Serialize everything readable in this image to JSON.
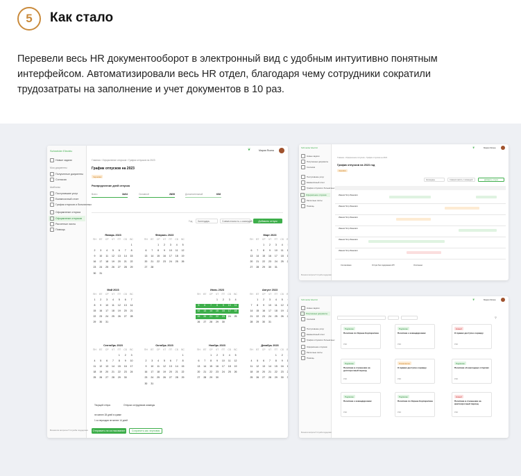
{
  "step_number": "5",
  "section_title": "Как стало",
  "description": "Перевели весь HR документооборот в электронный вид с удобным интуитивно понятным интерфейсом. Автоматизировали весь HR отдел, благодаря чему сотрудники сократили трудозатраты на заполнение и учет документов в 10 раз.",
  "colors": {
    "accent": "#c98a3b",
    "brand_green": "#3dae4a",
    "band_bg": "#eef0f4"
  },
  "app": {
    "brand": "Schneider Electric",
    "user_name": "Мария Ясина",
    "sidebar": [
      "Новые задачи",
      "Мои документы",
      "Полученные документы",
      "Согласия",
      "Шаблоны",
      "Поступившие услуг",
      "Ежемесячный отчет",
      "График отпусков и больничных",
      "Оформление отпуска",
      "Оформление отпусков",
      "Расчетные листы",
      "Помощь"
    ],
    "sidebar_footer": "Возникли вопросы? Служба поддержки",
    "breadcrumb": "Главная › Оформление отпусков › График отпусков на 2023",
    "title": "График отпусков на 2023",
    "status_badge": "Черновик",
    "distribution_title": "Распределение дней отпуска",
    "stats": [
      {
        "label": "Всего",
        "value": "34/44"
      },
      {
        "label": "Основной",
        "value": "28/28"
      },
      {
        "label": "Дополнительный",
        "value": "6/16"
      }
    ],
    "filters": {
      "year_label": "Год",
      "calendar_select": "Календарь",
      "compare_select": "Совместимость с командой",
      "add_button": "Добавить отпуск"
    },
    "legend": [
      "Текущий отпуск",
      "Отпуска сотрудников команды"
    ],
    "checks": [
      "не менее 28 дней в сумме",
      "1 из периодов не менее 14 дней"
    ],
    "primary_button": "Отправить на согласование",
    "secondary_button": "Сохранить как черновик",
    "weekdays": [
      "ПН",
      "ВТ",
      "СР",
      "ЧТ",
      "ПТ",
      "СБ",
      "ВС"
    ],
    "months": [
      {
        "name": "Январь 2023",
        "offset": 6,
        "days": 31
      },
      {
        "name": "Февраль 2023",
        "offset": 2,
        "days": 28
      },
      {
        "name": "Март 2023",
        "offset": 2,
        "days": 31
      },
      {
        "name": "Май 2023",
        "offset": 0,
        "days": 31
      },
      {
        "name": "Июнь 2023",
        "offset": 3,
        "days": 30
      },
      {
        "name": "Август 2023",
        "offset": 1,
        "days": 31
      },
      {
        "name": "Сентябрь 2023",
        "offset": 4,
        "days": 30
      },
      {
        "name": "Октябрь 2023",
        "offset": 6,
        "days": 31
      },
      {
        "name": "Ноябрь 2023",
        "offset": 2,
        "days": 30
      },
      {
        "name": "Декабрь 2023",
        "offset": 4,
        "days": 31
      }
    ],
    "selected_month": "Июнь 2023",
    "selected_days": [
      5,
      6,
      7,
      8,
      9,
      10,
      11,
      12,
      13,
      14,
      15,
      16,
      17,
      18,
      19,
      20,
      21,
      22,
      23
    ],
    "gantt": {
      "title": "График отпусков на 2023 год",
      "rows": [
        {
          "name": "Иванов Петр Иванович"
        },
        {
          "name": "Иванов Петр Иванович"
        },
        {
          "name": "Иванов Петр Иванович"
        },
        {
          "name": "Иванов Петр Иванович"
        },
        {
          "name": "Иванов Петр Иванович"
        },
        {
          "name": "Иванов Петр Иванович"
        }
      ],
      "legend": [
        "Согласовано",
        "Отпуск без содержания ЗП",
        "Отклонено"
      ]
    },
    "documents": [
      {
        "status": "Подписан",
        "title": "Политика по Охране Корпоративн",
        "type": "PDF"
      },
      {
        "status": "Подписан",
        "title": "Политика о командировках",
        "type": "PDF"
      },
      {
        "status": "Новый",
        "title": "О правах доступа к серверу",
        "type": "PDF"
      },
      {
        "status": "Подписан",
        "title": "Политика в отношении на долгосрочный период",
        "type": "PDF"
      },
      {
        "status": "Ознакомлен",
        "title": "О правах доступа к серверу",
        "type": "PDF"
      },
      {
        "status": "Подписан",
        "title": "Политика об ежегодных отпусках",
        "type": "PDF"
      },
      {
        "status": "Подписан",
        "title": "Политика о командировках",
        "type": "PDF"
      },
      {
        "status": "Подписан",
        "title": "Политика по Охране Корпоративн",
        "type": "PDF"
      },
      {
        "status": "Новый",
        "title": "Политика в отношении на краткосрочный период",
        "type": "PDF"
      }
    ]
  }
}
